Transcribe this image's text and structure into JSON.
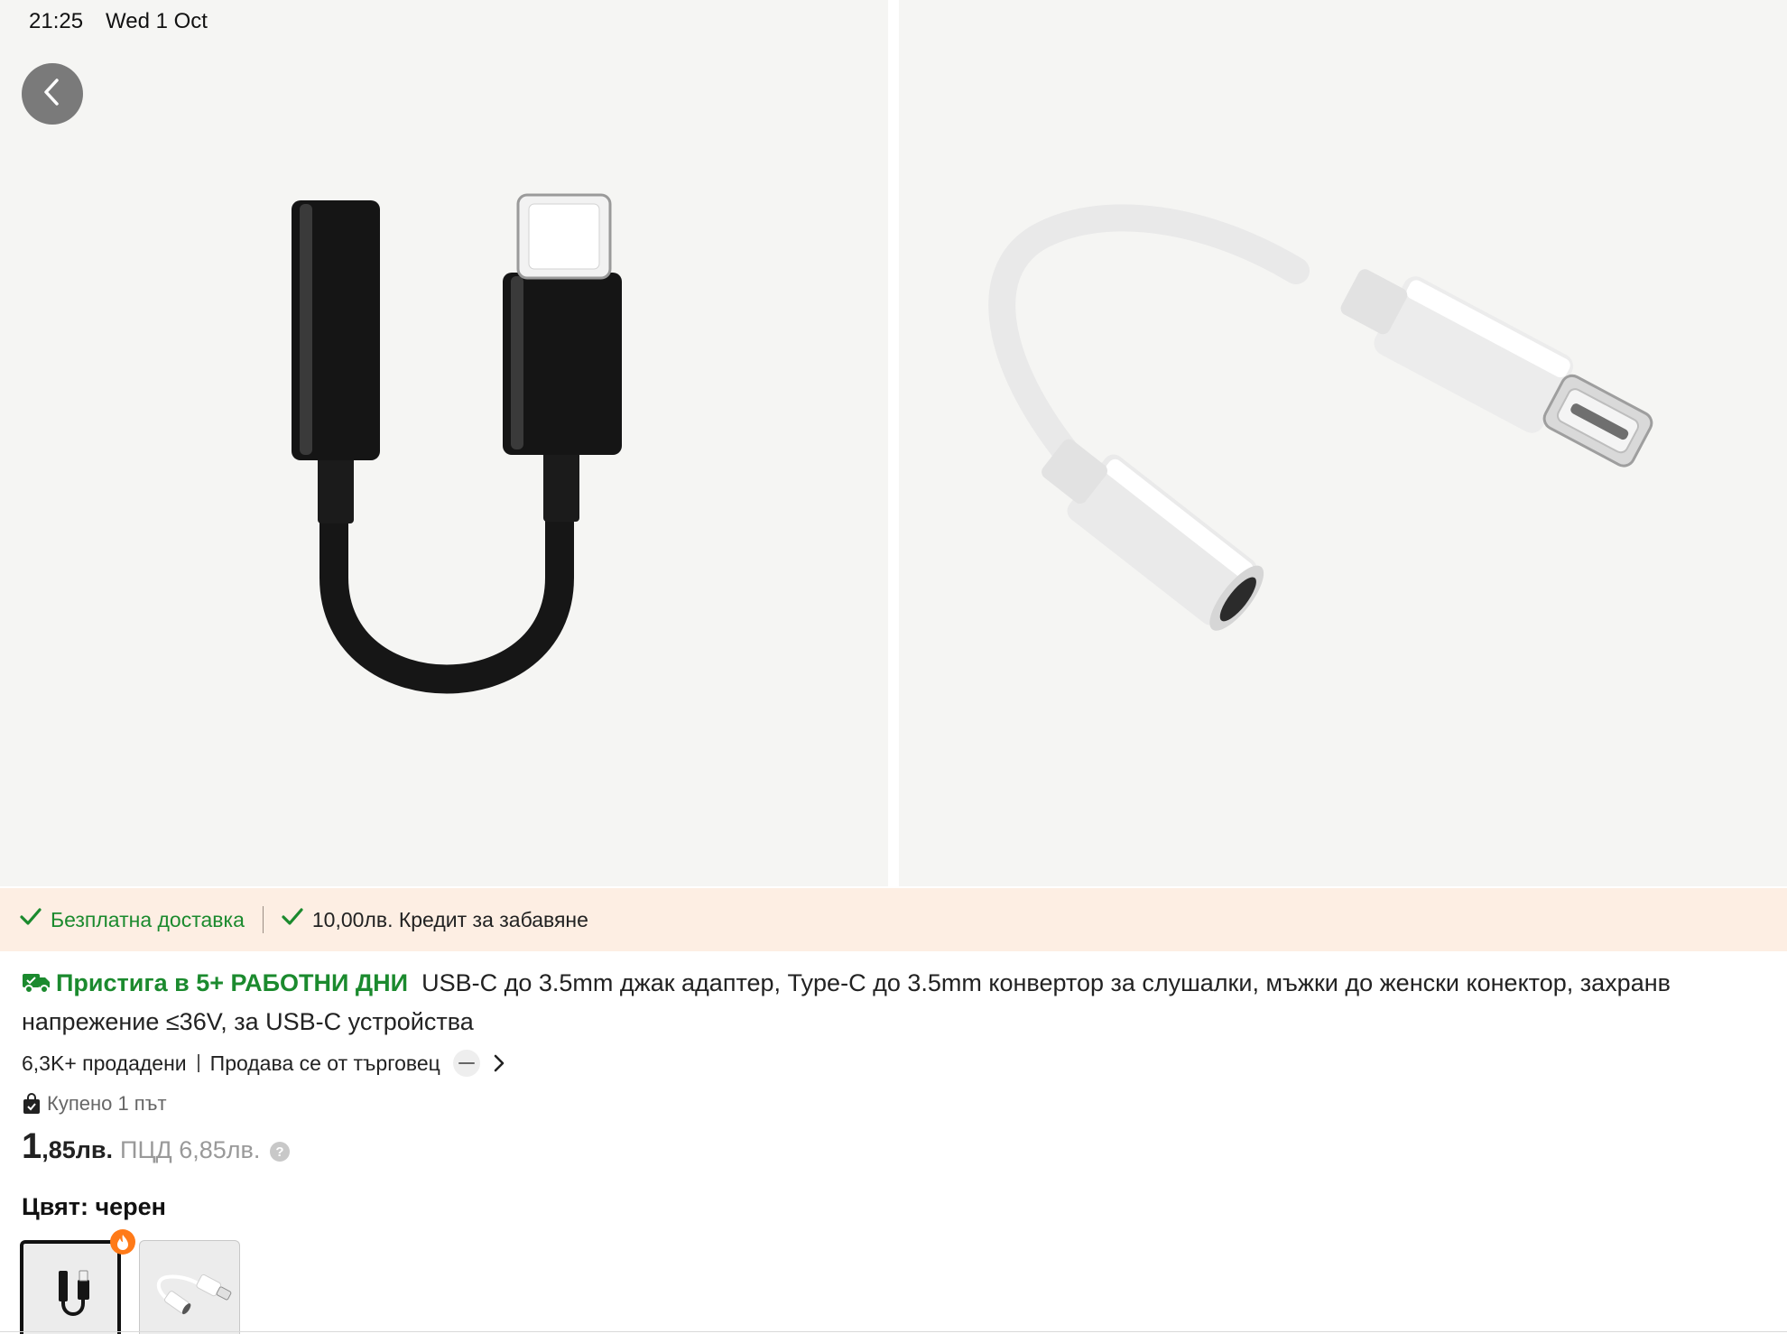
{
  "status_bar": {
    "time": "21:25",
    "date": "Wed 1 Oct"
  },
  "gallery": {
    "images": [
      {
        "alt": "black USB-C to 3.5mm adapter"
      },
      {
        "alt": "white USB-C to 3.5mm adapter"
      }
    ],
    "back_icon": "chevron-left-icon"
  },
  "benefits": {
    "free_shipping": "Безплатна доставка",
    "credit": "10,00лв. Кредит за забавяне",
    "check_icon": "check-icon"
  },
  "product": {
    "arrival": "Пристига в 5+ РАБОТНИ ДНИ",
    "title_line1": "USB-C до 3.5mm джак адаптер, Type-C до 3.5mm конвертор за слушалки, мъжки до женски конектор, захранв",
    "title_line2": "напрежение ≤36V, за USB-C устройства",
    "sold": "6,3K+ продадени",
    "seller_text": "Продава се от търговец",
    "purchased": "Купено 1 път",
    "price_int": "1",
    "price_frac": ",85лв.",
    "vat_price": "ПЦД 6,85лв.",
    "color_label": "Цвят:",
    "color_value": "черен"
  },
  "colors": {
    "accent_green": "#1b8a2e",
    "benefits_bg": "#fdeee3",
    "badge_orange": "#ff7a18"
  }
}
